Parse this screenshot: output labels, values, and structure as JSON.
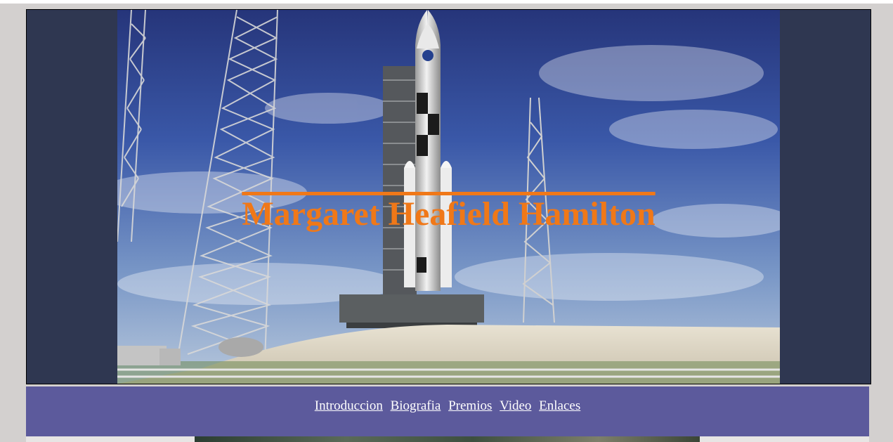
{
  "hero": {
    "title": "Margaret Heafield Hamilton",
    "image": "rocket-launch-pad"
  },
  "nav": {
    "items": [
      {
        "label": "Introduccion"
      },
      {
        "label": "Biografia"
      },
      {
        "label": "Premios"
      },
      {
        "label": "Video"
      },
      {
        "label": "Enlaces"
      }
    ]
  },
  "colors": {
    "page_background": "#d3d0cf",
    "hero_background": "#2f3751",
    "title": "#f07818",
    "nav_background": "#5c5a9c",
    "nav_link": "#ffffff"
  }
}
